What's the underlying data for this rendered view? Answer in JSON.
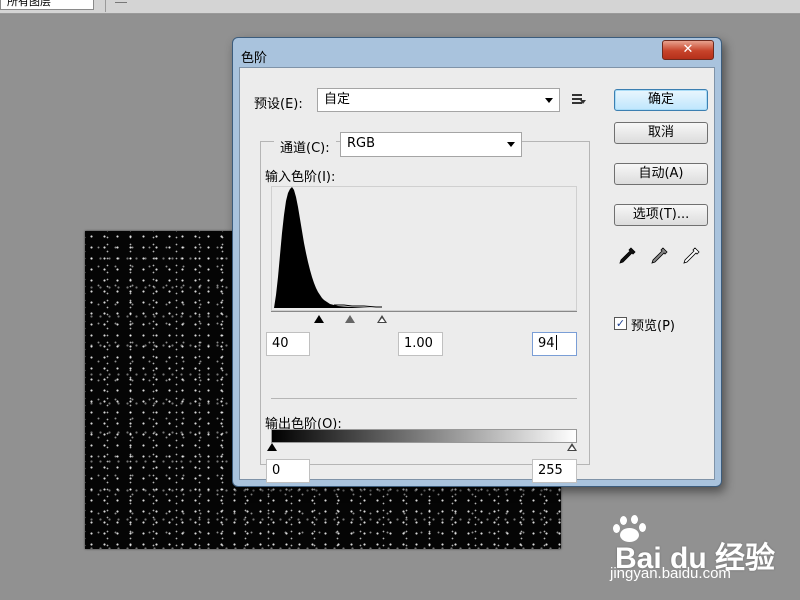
{
  "topbar": {
    "field_text": "所有图层"
  },
  "dialog": {
    "title": "色阶",
    "close_glyph": "✕",
    "preset": {
      "label": "预设(E):",
      "value": "自定"
    },
    "channel": {
      "label": "通道(C):",
      "value": "RGB"
    },
    "input_levels": {
      "label": "输入色阶(I):",
      "black": "40",
      "gamma": "1.00",
      "white": "94"
    },
    "output_levels": {
      "label": "输出色阶(O):",
      "black": "0",
      "white": "255"
    },
    "buttons": {
      "ok": "确定",
      "cancel": "取消",
      "auto": "自动(A)",
      "options": "选项(T)..."
    },
    "preview": {
      "label": "预览(P)",
      "checked": true,
      "check_glyph": "✓"
    }
  },
  "watermark": {
    "brand": "Bai du 经验",
    "url": "jingyan.baidu.com"
  },
  "colors": {
    "primary_button": "#bee6fd",
    "close_button": "#c7432a",
    "title_bar": "#a9c3dd"
  }
}
